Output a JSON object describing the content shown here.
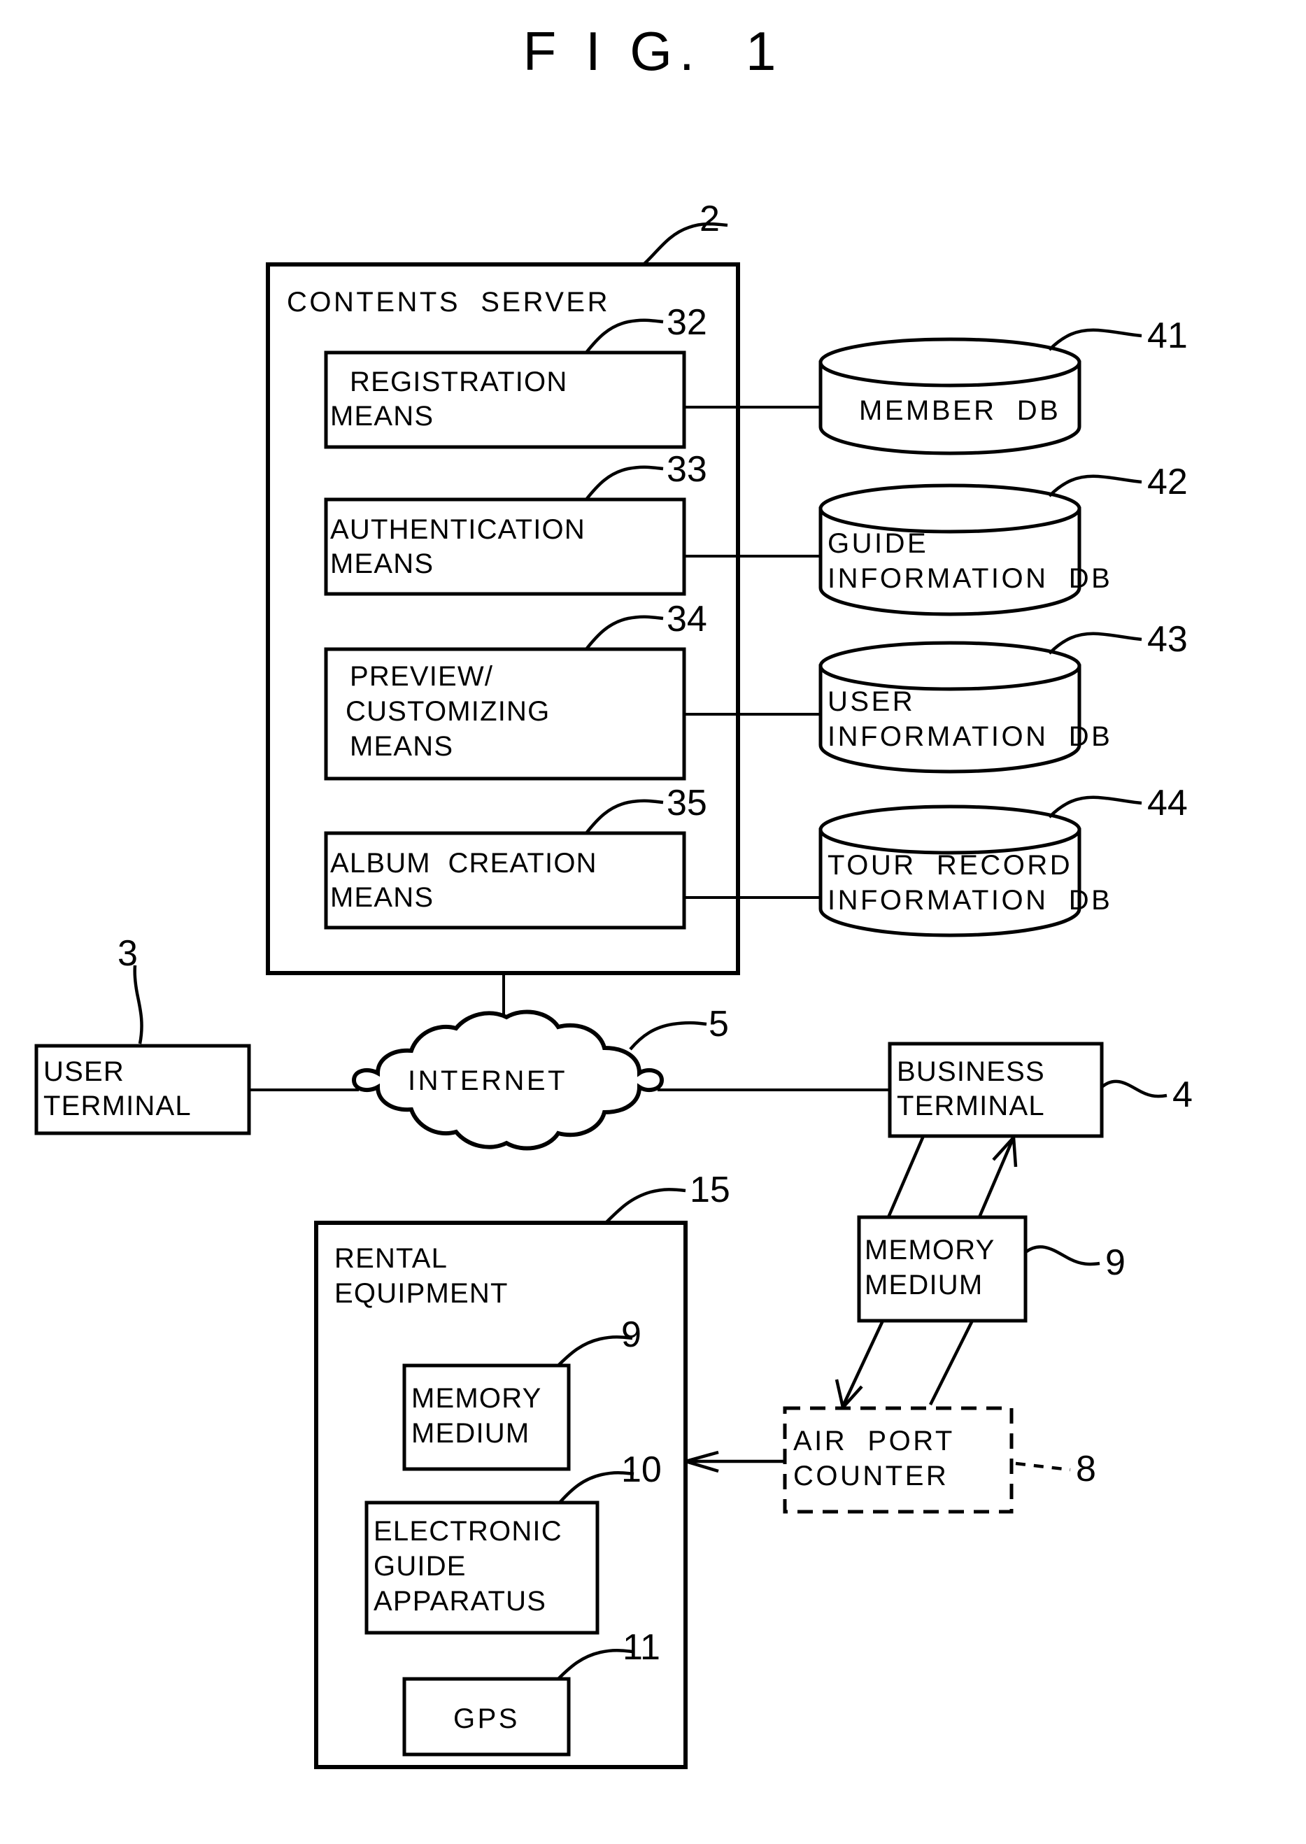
{
  "figure": {
    "title": "F I G.  1"
  },
  "nodes": {
    "contents_server": {
      "label": "CONTENTS  SERVER",
      "ref": "2"
    },
    "registration_means": {
      "line1": "REGISTRATION",
      "line2": "MEANS",
      "ref": "32"
    },
    "authentication_means": {
      "line1": "AUTHENTICATION",
      "line2": "MEANS",
      "ref": "33"
    },
    "preview_customizing_means": {
      "line1": "PREVIEW/",
      "line2": "CUSTOMIZING",
      "line3": "MEANS",
      "ref": "34"
    },
    "album_creation_means": {
      "line1": "ALBUM  CREATION",
      "line2": "MEANS",
      "ref": "35"
    },
    "member_db": {
      "line1": "MEMBER  DB",
      "line2": "",
      "ref": "41"
    },
    "guide_information_db": {
      "line1": "GUIDE",
      "line2": "INFORMATION  DB",
      "ref": "42"
    },
    "user_information_db": {
      "line1": "USER",
      "line2": "INFORMATION  DB",
      "ref": "43"
    },
    "tour_record_information_db": {
      "line1": "TOUR  RECORD",
      "line2": "INFORMATION  DB",
      "ref": "44"
    },
    "user_terminal": {
      "line1": "USER",
      "line2": "TERMINAL",
      "ref": "3"
    },
    "internet": {
      "label": "INTERNET",
      "ref": "5"
    },
    "business_terminal": {
      "line1": "BUSINESS",
      "line2": "TERMINAL",
      "ref": "4"
    },
    "memory_medium_business": {
      "line1": "MEMORY",
      "line2": "MEDIUM",
      "ref": "9"
    },
    "air_port_counter": {
      "line1": "AIR  PORT",
      "line2": "COUNTER",
      "ref": "8"
    },
    "rental_equipment": {
      "line1": "RENTAL",
      "line2": "EQUIPMENT",
      "ref": "15"
    },
    "memory_medium_rental": {
      "line1": "MEMORY",
      "line2": "MEDIUM",
      "ref": "9"
    },
    "electronic_guide_apparatus": {
      "line1": "ELECTRONIC",
      "line2": "GUIDE",
      "line3": "APPARATUS",
      "ref": "10"
    },
    "gps": {
      "label": "GPS",
      "ref": "11"
    }
  },
  "colors": {
    "ink": "#000000",
    "paper": "#ffffff"
  }
}
